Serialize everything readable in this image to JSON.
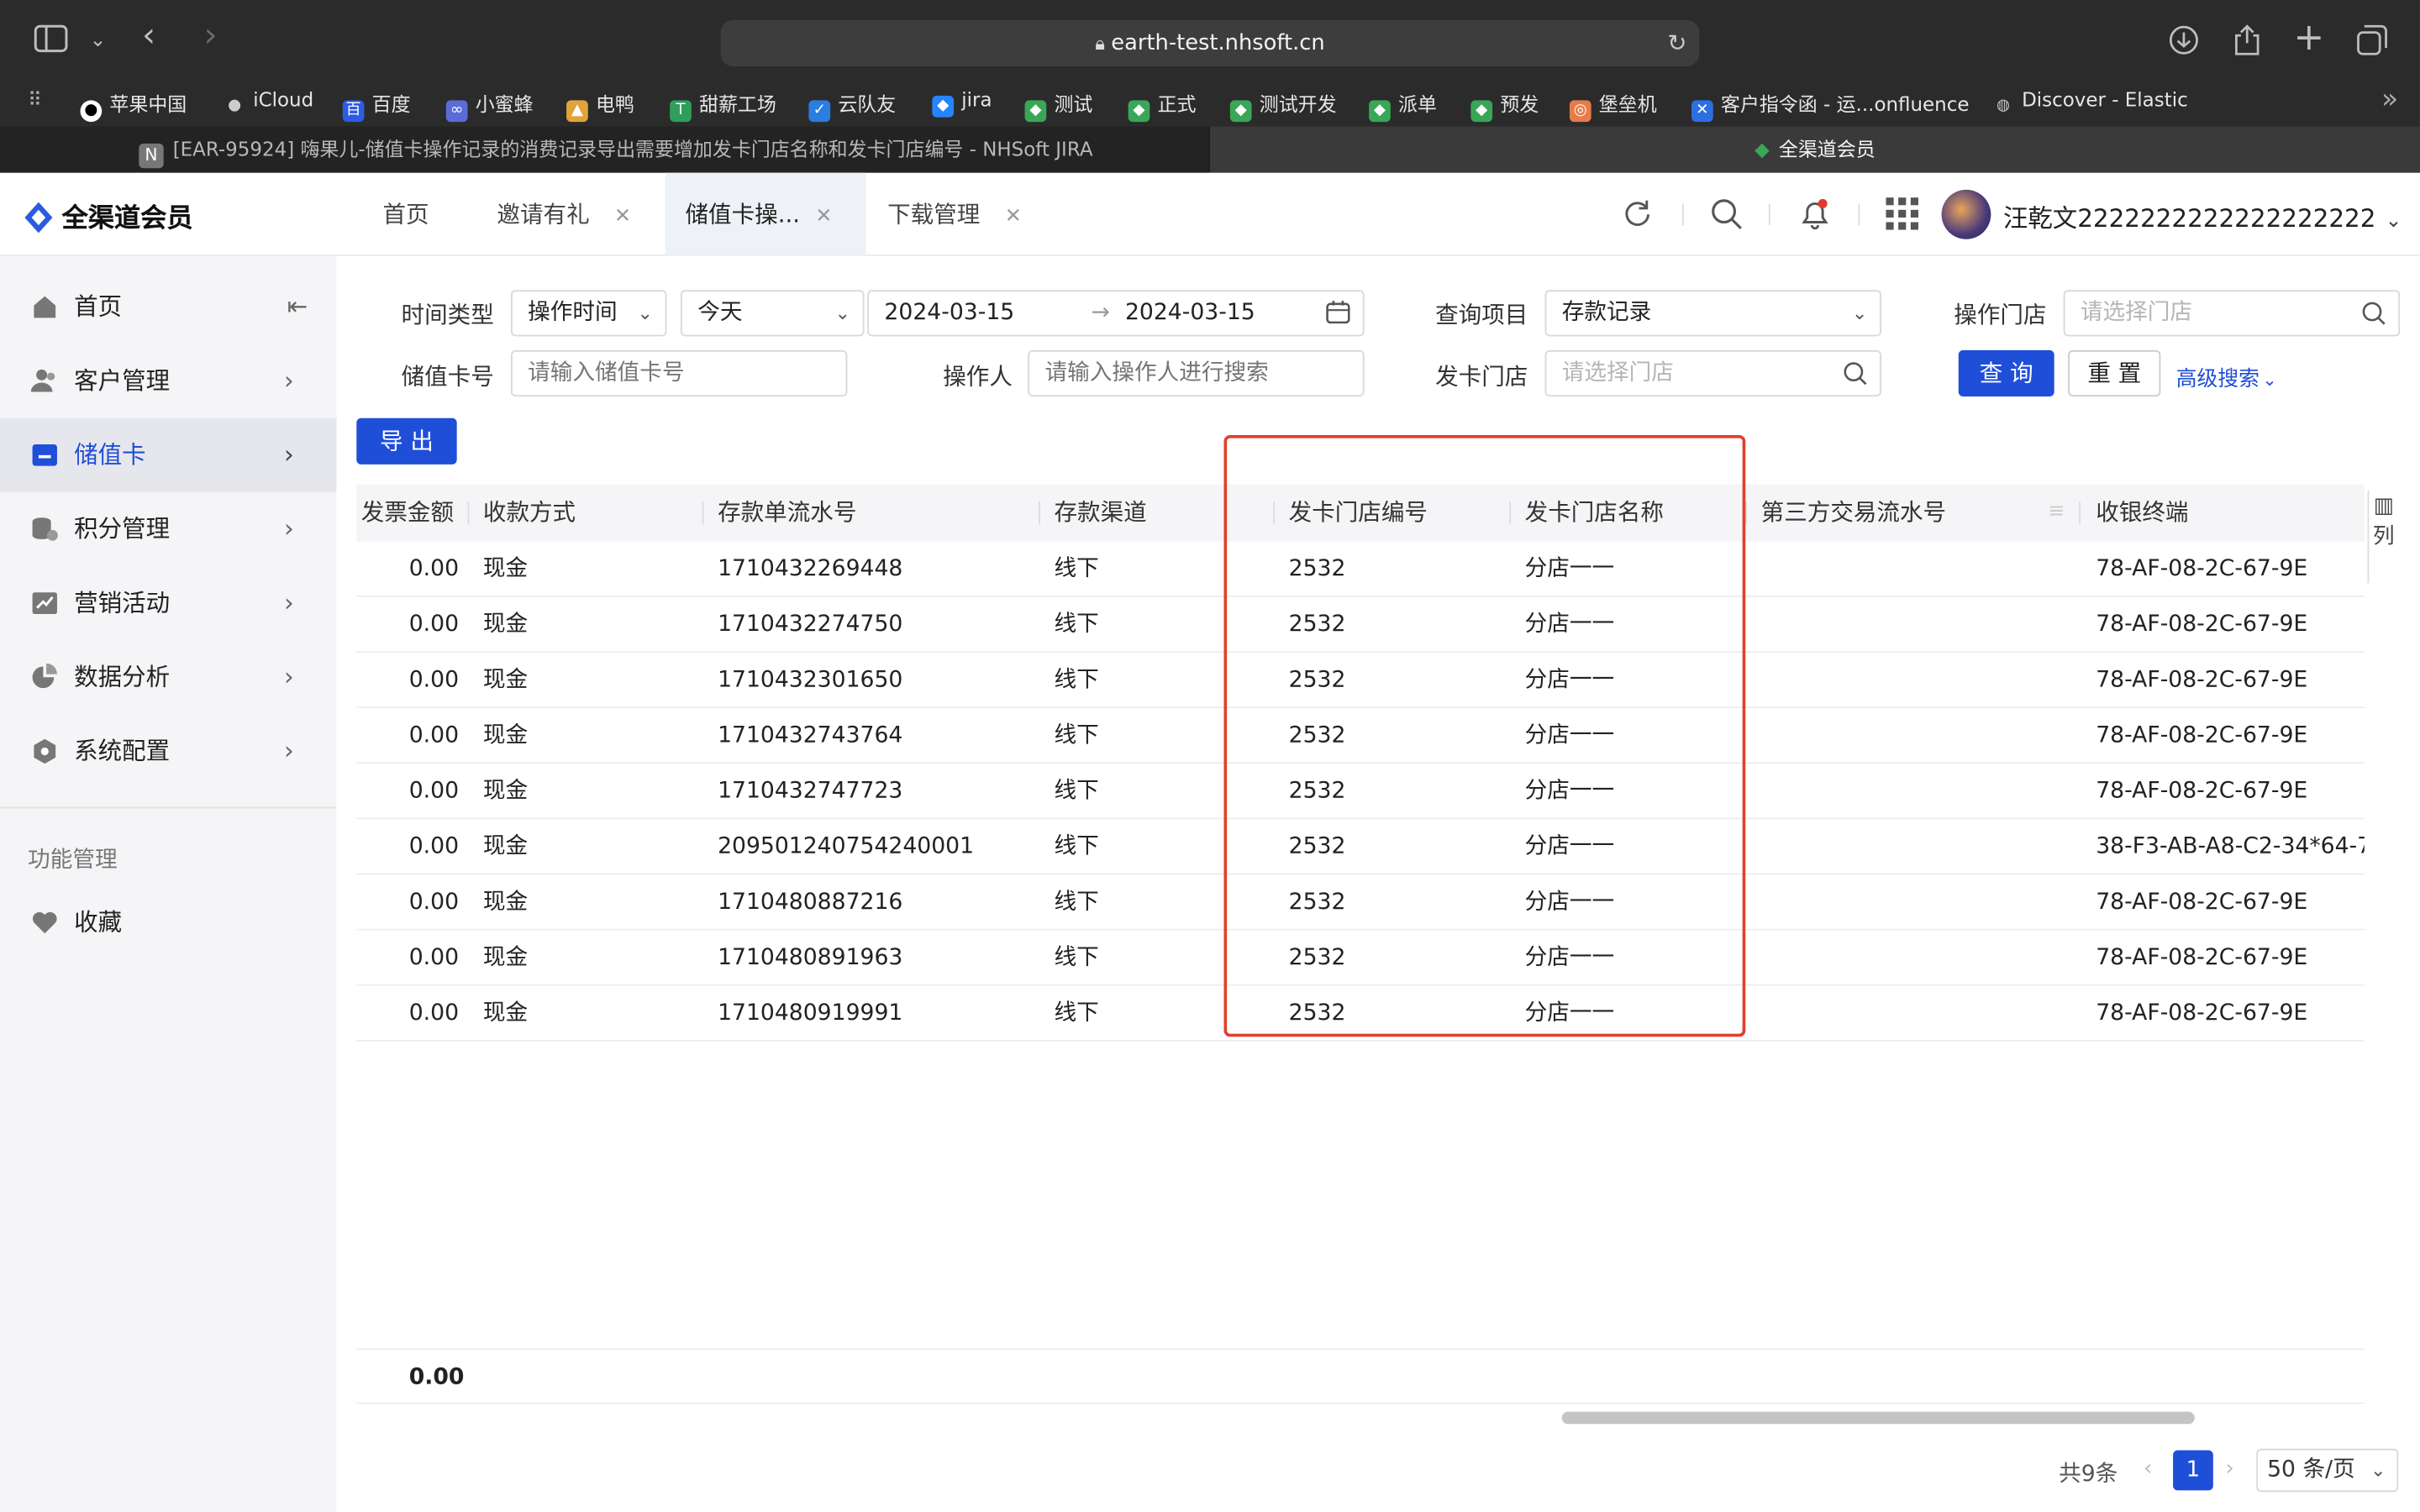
{
  "browser": {
    "url": "earth-test.nhsoft.cn",
    "bookmarks": [
      {
        "label": "苹果中国",
        "icon": "apple-icon"
      },
      {
        "label": "iCloud",
        "icon": "apple-icon"
      },
      {
        "label": "百度",
        "icon": "baidu-icon"
      },
      {
        "label": "小蜜蜂",
        "icon": "bee-icon"
      },
      {
        "label": "电鸭",
        "icon": "duck-icon"
      },
      {
        "label": "甜薪工场",
        "icon": "t-icon"
      },
      {
        "label": "云队友",
        "icon": "cloud-icon"
      },
      {
        "label": "jira",
        "icon": "jira-icon"
      },
      {
        "label": "测试",
        "icon": "leaf-icon"
      },
      {
        "label": "正式",
        "icon": "leaf-icon"
      },
      {
        "label": "测试开发",
        "icon": "leaf-icon"
      },
      {
        "label": "派单",
        "icon": "leaf-icon"
      },
      {
        "label": "预发",
        "icon": "leaf-icon"
      },
      {
        "label": "堡垒机",
        "icon": "fortress-icon"
      },
      {
        "label": "客户指令函 - 运...onfluence",
        "icon": "confluence-icon"
      },
      {
        "label": "Discover - Elastic",
        "icon": "globe-icon"
      }
    ],
    "tabs": [
      {
        "label": "[EAR-95924] 嗨果儿-储值卡操作记录的消费记录导出需要增加发卡门店名称和发卡门店编号 - NHSoft JIRA",
        "favicon": "N"
      },
      {
        "label": "全渠道会员"
      }
    ]
  },
  "app": {
    "logo": "全渠道会员",
    "page_tabs": [
      {
        "label": "首页",
        "closable": false
      },
      {
        "label": "邀请有礼",
        "closable": true
      },
      {
        "label": "储值卡操...",
        "closable": true,
        "active": true
      },
      {
        "label": "下载管理",
        "closable": true
      }
    ],
    "user": "汪乾文2222222222222222222"
  },
  "sidebar": {
    "items": [
      {
        "label": "首页",
        "icon": "home-icon"
      },
      {
        "label": "客户管理",
        "icon": "users-icon"
      },
      {
        "label": "储值卡",
        "icon": "card-icon",
        "active": true
      },
      {
        "label": "积分管理",
        "icon": "coins-icon"
      },
      {
        "label": "营销活动",
        "icon": "chart-icon"
      },
      {
        "label": "数据分析",
        "icon": "pie-icon"
      },
      {
        "label": "系统配置",
        "icon": "settings-icon"
      }
    ],
    "section": "功能管理",
    "section_items": [
      {
        "label": "收藏",
        "icon": "heart-icon"
      }
    ]
  },
  "filters": {
    "time_type_label": "时间类型",
    "time_type_value": "操作时间",
    "range_value": "今天",
    "date_start": "2024-03-15",
    "date_end": "2024-03-15",
    "query_item_label": "查询项目",
    "query_item_value": "存款记录",
    "op_store_label": "操作门店",
    "op_store_placeholder": "请选择门店",
    "card_no_label": "储值卡号",
    "card_no_placeholder": "请输入储值卡号",
    "operator_label": "操作人",
    "operator_placeholder": "请输入操作人进行搜索",
    "issue_store_label": "发卡门店",
    "issue_store_placeholder": "请选择门店",
    "search_btn": "查 询",
    "reset_btn": "重 置",
    "advanced": "高级搜索",
    "export_btn": "导 出"
  },
  "table": {
    "columns": [
      "发票金额",
      "收款方式",
      "存款单流水号",
      "存款渠道",
      "发卡门店编号",
      "发卡门店名称",
      "第三方交易流水号",
      "收银终端"
    ],
    "rows": [
      [
        "0.00",
        "现金",
        "1710432269448",
        "线下",
        "2532",
        "分店一一",
        "",
        "78-AF-08-2C-67-9E"
      ],
      [
        "0.00",
        "现金",
        "1710432274750",
        "线下",
        "2532",
        "分店一一",
        "",
        "78-AF-08-2C-67-9E"
      ],
      [
        "0.00",
        "现金",
        "1710432301650",
        "线下",
        "2532",
        "分店一一",
        "",
        "78-AF-08-2C-67-9E"
      ],
      [
        "0.00",
        "现金",
        "1710432743764",
        "线下",
        "2532",
        "分店一一",
        "",
        "78-AF-08-2C-67-9E"
      ],
      [
        "0.00",
        "现金",
        "1710432747723",
        "线下",
        "2532",
        "分店一一",
        "",
        "78-AF-08-2C-67-9E"
      ],
      [
        "0.00",
        "现金",
        "209501240754240001",
        "线下",
        "2532",
        "分店一一",
        "",
        "38-F3-AB-A8-C2-34*64-7"
      ],
      [
        "0.00",
        "现金",
        "1710480887216",
        "线下",
        "2532",
        "分店一一",
        "",
        "78-AF-08-2C-67-9E"
      ],
      [
        "0.00",
        "现金",
        "1710480891963",
        "线下",
        "2532",
        "分店一一",
        "",
        "78-AF-08-2C-67-9E"
      ],
      [
        "0.00",
        "现金",
        "1710480919991",
        "线下",
        "2532",
        "分店一一",
        "",
        "78-AF-08-2C-67-9E"
      ]
    ],
    "summary": "0.00",
    "column_settings": "列"
  },
  "pagination": {
    "total": "共9条",
    "current": "1",
    "page_size": "50 条/页"
  },
  "colors": {
    "primary": "#1f4ed8",
    "highlight": "#e0412c"
  }
}
